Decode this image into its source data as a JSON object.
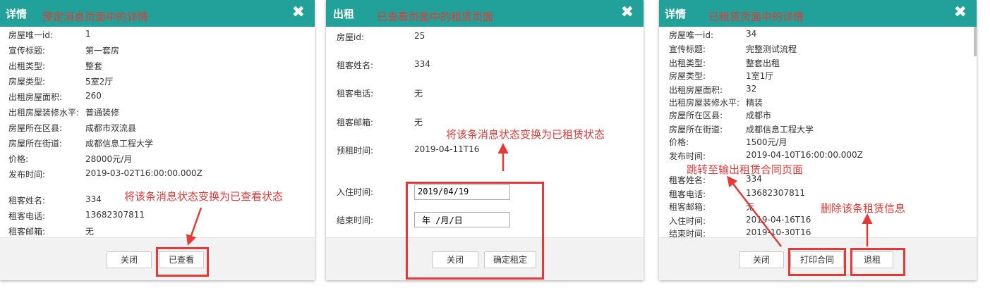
{
  "colors": {
    "header": "#21a19a",
    "annotation": "#e53935"
  },
  "icons": {
    "close": "close-icon"
  },
  "dialog1": {
    "title": "详情",
    "note": "预定消息页面中的详情",
    "close_glyph": "✖",
    "rows": [
      {
        "label": "房屋唯一id:",
        "value": "1"
      },
      {
        "label": "宣传标题:",
        "value": "第一套房"
      },
      {
        "label": "出租类型:",
        "value": "整套"
      },
      {
        "label": "房屋类型:",
        "value": "5室2厅"
      },
      {
        "label": "出租房屋面积:",
        "value": "260"
      },
      {
        "label": "出租房屋装修水平:",
        "value": "普通装修"
      },
      {
        "label": "房屋所在区县:",
        "value": "成都市双流县"
      },
      {
        "label": "房屋所在街道:",
        "value": "成都信息工程大学"
      },
      {
        "label": "价格:",
        "value": "28000元/月"
      },
      {
        "label": "发布时间:",
        "value": "2019-03-02T16:00:00.000Z"
      },
      {
        "label": "租客姓名:",
        "value": "334"
      },
      {
        "label": "租客电话:",
        "value": "13682307811"
      },
      {
        "label": "租客邮箱:",
        "value": "无"
      }
    ],
    "buttons": {
      "close": "关闭",
      "viewed": "已查看"
    },
    "annotation": "将该条消息状态变换为已查看状态"
  },
  "dialog2": {
    "title": "出租",
    "note": "已查看页面中的租赁页面",
    "close_glyph": "✖",
    "rows": [
      {
        "label": "房屋id:",
        "value": "25"
      },
      {
        "label": "租客姓名:",
        "value": "334"
      },
      {
        "label": "租客电话:",
        "value": "无"
      },
      {
        "label": "租客邮箱:",
        "value": "无"
      },
      {
        "label": "预租时间:",
        "value": "2019-04-11T16"
      }
    ],
    "checkin_label": "入住时间:",
    "checkin_value": "2019/04/19",
    "end_label": "结束时间:",
    "end_placeholder": "年 /月/日",
    "buttons": {
      "close": "关闭",
      "confirm": "确定租定"
    },
    "annotation": "将该条消息状态变换为已租赁状态"
  },
  "dialog3": {
    "title": "详情",
    "note": "已租赁页面中的详情",
    "close_glyph": "✖",
    "rows": [
      {
        "label": "房屋唯一id:",
        "value": "34"
      },
      {
        "label": "宣传标题:",
        "value": "完整测试流程"
      },
      {
        "label": "出租类型:",
        "value": "整套出租"
      },
      {
        "label": "房屋类型:",
        "value": "1室1厅"
      },
      {
        "label": "出租房屋面积:",
        "value": "32"
      },
      {
        "label": "出租房屋装修水平:",
        "value": "精装"
      },
      {
        "label": "房屋所在区县:",
        "value": "成都市"
      },
      {
        "label": "房屋所在街道:",
        "value": "成都信息工程大学"
      },
      {
        "label": "价格:",
        "value": "1500元/月"
      },
      {
        "label": "发布时间:",
        "value": "2019-04-10T16:00:00.000Z"
      },
      {
        "label": "租客姓名:",
        "value": "334"
      },
      {
        "label": "租客电话:",
        "value": "13682307811"
      },
      {
        "label": "租客邮箱:",
        "value": "无"
      },
      {
        "label": "入住时间:",
        "value": "2019-04-16T16"
      },
      {
        "label": "结束时间:",
        "value": "2019-10-30T16"
      }
    ],
    "buttons": {
      "close": "关闭",
      "print": "打印合同",
      "checkout": "退租"
    },
    "annotation_print": "跳转至输出租赁合同页面",
    "annotation_checkout": "删除该条租赁信息"
  }
}
